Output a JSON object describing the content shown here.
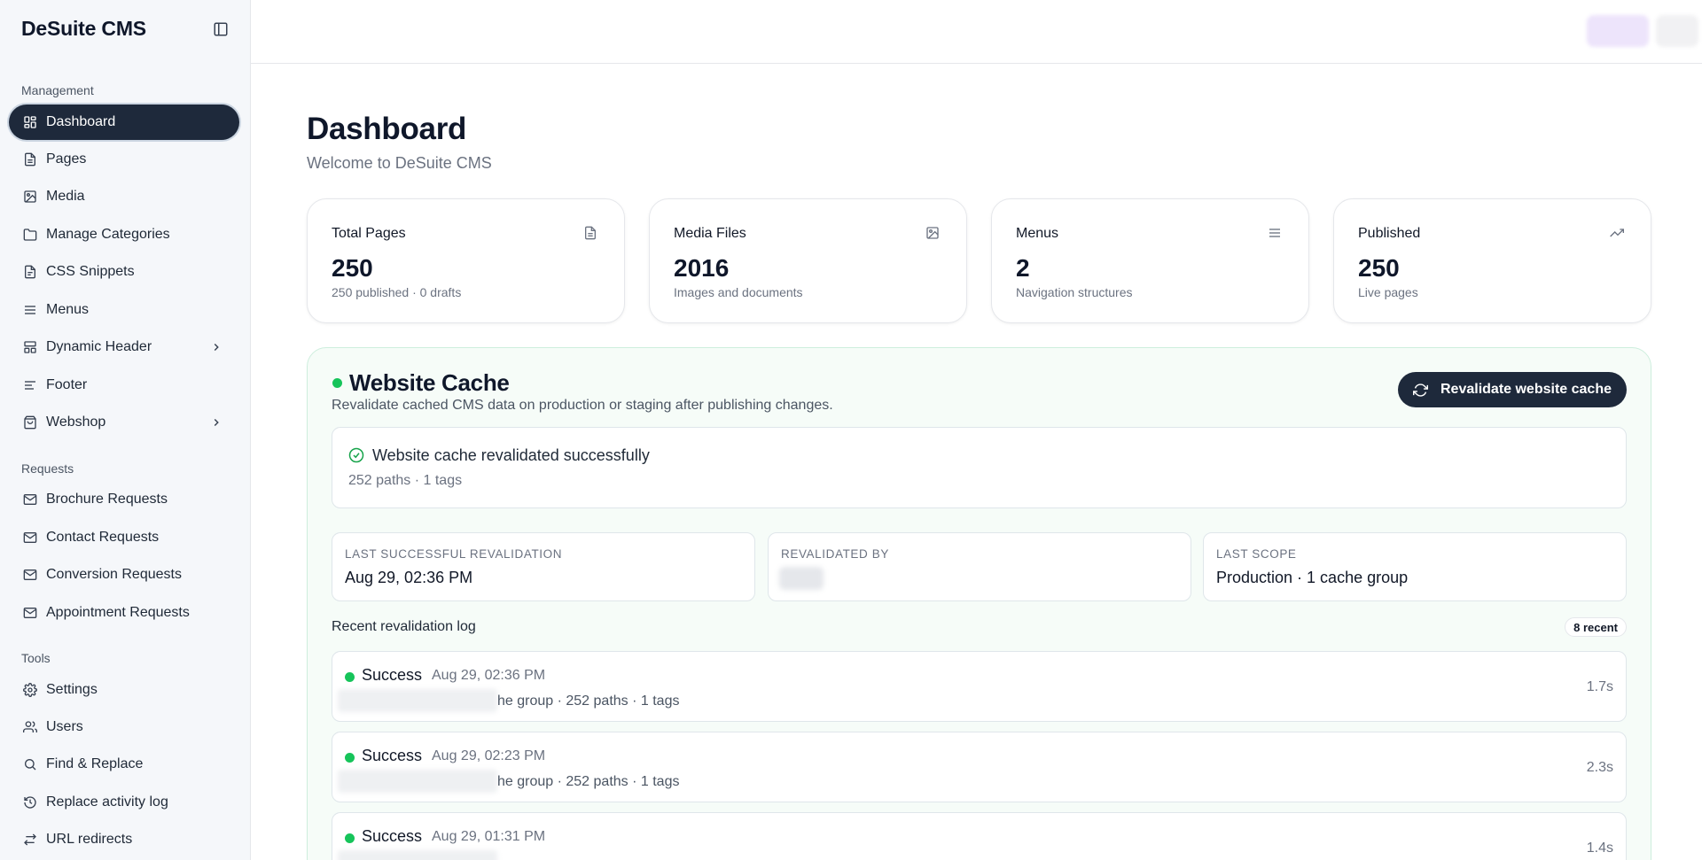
{
  "sidebar": {
    "brand": "DeSuite CMS",
    "sections": {
      "management": "Management",
      "requests": "Requests",
      "tools": "Tools"
    },
    "items": [
      {
        "label": "Dashboard",
        "icon": "dashboard-icon",
        "active": true
      },
      {
        "label": "Pages",
        "icon": "file-text-icon"
      },
      {
        "label": "Media",
        "icon": "image-icon"
      },
      {
        "label": "Manage Categories",
        "icon": "folder-icon"
      },
      {
        "label": "CSS Snippets",
        "icon": "file-code-icon"
      },
      {
        "label": "Menus",
        "icon": "menu-icon"
      },
      {
        "label": "Dynamic Header",
        "icon": "layout-icon",
        "expandable": true
      },
      {
        "label": "Footer",
        "icon": "align-left-icon"
      },
      {
        "label": "Webshop",
        "icon": "shopping-bag-icon",
        "expandable": true
      },
      {
        "label": "Brochure Requests",
        "icon": "mail-icon"
      },
      {
        "label": "Contact Requests",
        "icon": "mail-icon"
      },
      {
        "label": "Conversion Requests",
        "icon": "mail-icon"
      },
      {
        "label": "Appointment Requests",
        "icon": "mail-icon"
      },
      {
        "label": "Settings",
        "icon": "gear-icon"
      },
      {
        "label": "Users",
        "icon": "users-icon"
      },
      {
        "label": "Find & Replace",
        "icon": "search-icon"
      },
      {
        "label": "Replace activity log",
        "icon": "history-icon"
      },
      {
        "label": "URL redirects",
        "icon": "redirect-icon"
      }
    ]
  },
  "main": {
    "title": "Dashboard",
    "subtitle": "Welcome to DeSuite CMS",
    "stats": [
      {
        "label": "Total Pages",
        "value": "250",
        "desc": "250 published · 0 drafts",
        "icon": "file-text-icon"
      },
      {
        "label": "Media Files",
        "value": "2016",
        "desc": "Images and documents",
        "icon": "image-icon"
      },
      {
        "label": "Menus",
        "value": "2",
        "desc": "Navigation structures",
        "icon": "menu-icon"
      },
      {
        "label": "Published",
        "value": "250",
        "desc": "Live pages",
        "icon": "trending-up-icon"
      }
    ]
  },
  "cache": {
    "title": "Website Cache",
    "subtitle": "Revalidate cached CMS data on production or staging after publishing changes.",
    "button_label": "Revalidate website cache",
    "success_message": "Website cache revalidated successfully",
    "success_meta": "252 paths · 1 tags",
    "info": [
      {
        "label": "LAST SUCCESSFUL REVALIDATION",
        "value": "Aug 29, 02:36 PM"
      },
      {
        "label": "REVALIDATED BY",
        "value": ""
      },
      {
        "label": "LAST SCOPE",
        "value": "Production · 1 cache group"
      }
    ],
    "log_title": "Recent revalidation log",
    "log_badge": "8 recent",
    "log": [
      {
        "status": "Success",
        "time": "Aug 29, 02:36 PM",
        "detail": "he group · 252 paths · 1 tags",
        "duration": "1.7s"
      },
      {
        "status": "Success",
        "time": "Aug 29, 02:23 PM",
        "detail": "he group · 252 paths · 1 tags",
        "duration": "2.3s"
      },
      {
        "status": "Success",
        "time": "Aug 29, 01:31 PM",
        "detail": "",
        "duration": "1.4s"
      }
    ]
  },
  "colors": {
    "sidebar_bg": "#f5f7fa",
    "active_bg": "#1e293b",
    "success_green": "#16c45a",
    "cache_panel_bg": "#f6fcf8"
  }
}
